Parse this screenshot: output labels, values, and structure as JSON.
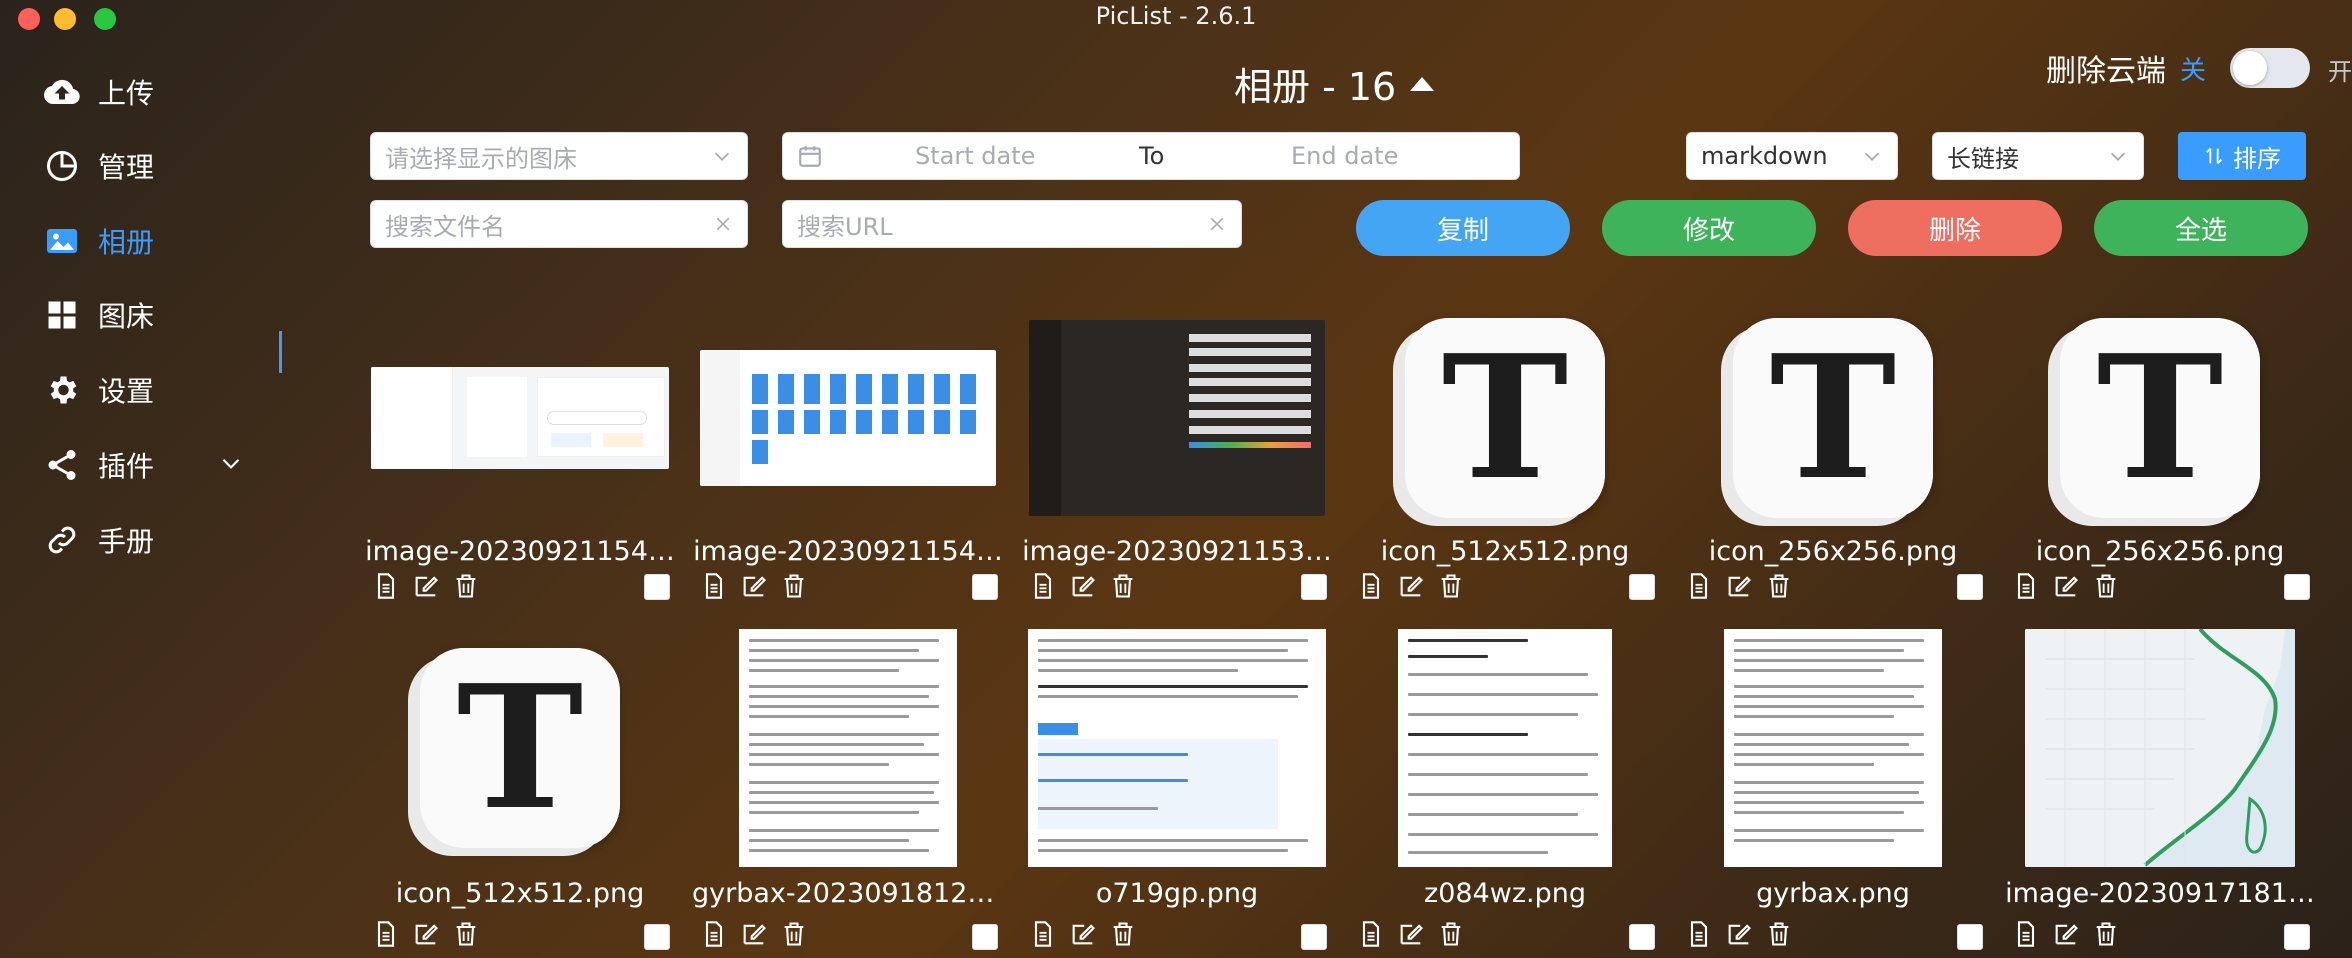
{
  "window": {
    "title": "PicList - 2.6.1"
  },
  "sidebar": {
    "items": [
      {
        "label": "上传",
        "icon": "cloud-upload-icon"
      },
      {
        "label": "管理",
        "icon": "pie-chart-icon"
      },
      {
        "label": "相册",
        "icon": "picture-icon"
      },
      {
        "label": "图床",
        "icon": "grid-icon"
      },
      {
        "label": "设置",
        "icon": "gear-icon"
      },
      {
        "label": "插件",
        "icon": "share-icon"
      },
      {
        "label": "手册",
        "icon": "link-icon"
      }
    ],
    "active": "相册"
  },
  "header": {
    "album_title": "相册 - 16",
    "cloud_delete_label": "删除云端",
    "cloud_toggle_off": "关",
    "cloud_toggle_on": "开"
  },
  "filters": {
    "bed_select_placeholder": "请选择显示的图床",
    "date_start_placeholder": "Start date",
    "date_separator": "To",
    "date_end_placeholder": "End date",
    "format_select": "markdown",
    "link_select": "长链接",
    "sort_label": "排序",
    "filename_search_placeholder": "搜索文件名",
    "url_search_placeholder": "搜索URL"
  },
  "actions": {
    "copy": "复制",
    "edit": "修改",
    "delete": "删除",
    "select_all": "全选"
  },
  "gallery": {
    "items": [
      {
        "name": "image-20230921154…",
        "kind": "screenshot-settings"
      },
      {
        "name": "image-20230921154…",
        "kind": "screenshot-files"
      },
      {
        "name": "image-20230921153…",
        "kind": "screenshot-dark"
      },
      {
        "name": "icon_512x512.png",
        "kind": "t-icon"
      },
      {
        "name": "icon_256x256.png",
        "kind": "t-icon"
      },
      {
        "name": "icon_256x256.png",
        "kind": "t-icon"
      },
      {
        "name": "icon_512x512.png",
        "kind": "t-icon"
      },
      {
        "name": "gyrbax-20230918122…",
        "kind": "document"
      },
      {
        "name": "o719gp.png",
        "kind": "document-web"
      },
      {
        "name": "z084wz.png",
        "kind": "document"
      },
      {
        "name": "gyrbax.png",
        "kind": "document"
      },
      {
        "name": "image-20230917181…",
        "kind": "map"
      }
    ]
  },
  "colors": {
    "accent": "#3b9cff",
    "copy": "#44a5f4",
    "edit": "#3fb25c",
    "delete": "#ee6f60",
    "select_all": "#3fb25c"
  }
}
